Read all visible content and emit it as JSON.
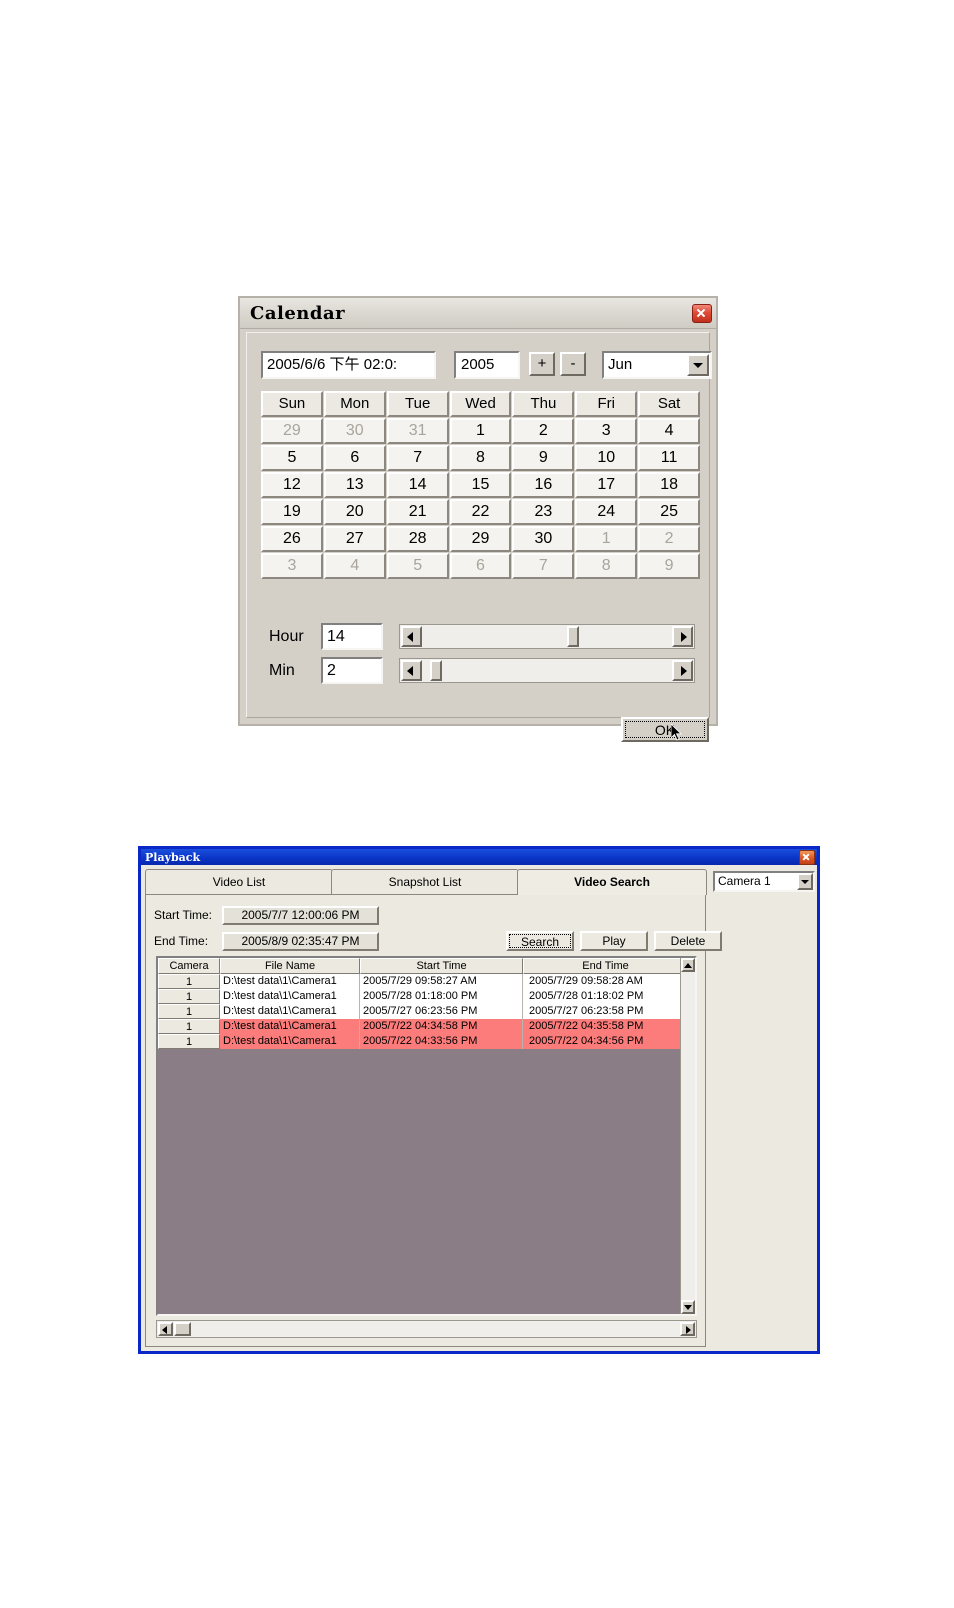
{
  "calendar": {
    "title": "Calendar",
    "close_icon": "close-icon",
    "datetime_value": "2005/6/6 下午 02:0:",
    "year_value": "2005",
    "plus_label": "+",
    "minus_label": "-",
    "month_value": "Jun",
    "month_arrow_icon": "chevron-down-icon",
    "weekdays": [
      "Sun",
      "Mon",
      "Tue",
      "Wed",
      "Thu",
      "Fri",
      "Sat"
    ],
    "weeks": [
      [
        {
          "d": "29",
          "dim": true
        },
        {
          "d": "30",
          "dim": true
        },
        {
          "d": "31",
          "dim": true
        },
        {
          "d": "1",
          "dim": false
        },
        {
          "d": "2",
          "dim": false
        },
        {
          "d": "3",
          "dim": false
        },
        {
          "d": "4",
          "dim": false
        }
      ],
      [
        {
          "d": "5",
          "dim": false
        },
        {
          "d": "6",
          "dim": false
        },
        {
          "d": "7",
          "dim": false
        },
        {
          "d": "8",
          "dim": false
        },
        {
          "d": "9",
          "dim": false
        },
        {
          "d": "10",
          "dim": false
        },
        {
          "d": "11",
          "dim": false
        }
      ],
      [
        {
          "d": "12",
          "dim": false
        },
        {
          "d": "13",
          "dim": false
        },
        {
          "d": "14",
          "dim": false
        },
        {
          "d": "15",
          "dim": false
        },
        {
          "d": "16",
          "dim": false
        },
        {
          "d": "17",
          "dim": false
        },
        {
          "d": "18",
          "dim": false
        }
      ],
      [
        {
          "d": "19",
          "dim": false
        },
        {
          "d": "20",
          "dim": false
        },
        {
          "d": "21",
          "dim": false
        },
        {
          "d": "22",
          "dim": false
        },
        {
          "d": "23",
          "dim": false
        },
        {
          "d": "24",
          "dim": false
        },
        {
          "d": "25",
          "dim": false
        }
      ],
      [
        {
          "d": "26",
          "dim": false
        },
        {
          "d": "27",
          "dim": false
        },
        {
          "d": "28",
          "dim": false
        },
        {
          "d": "29",
          "dim": false
        },
        {
          "d": "30",
          "dim": false
        },
        {
          "d": "1",
          "dim": true
        },
        {
          "d": "2",
          "dim": true
        }
      ],
      [
        {
          "d": "3",
          "dim": true
        },
        {
          "d": "4",
          "dim": true
        },
        {
          "d": "5",
          "dim": true
        },
        {
          "d": "6",
          "dim": true
        },
        {
          "d": "7",
          "dim": true
        },
        {
          "d": "8",
          "dim": true
        },
        {
          "d": "9",
          "dim": true
        }
      ]
    ],
    "hour_label": "Hour",
    "hour_value": "14",
    "hour_thumb_percent": 61,
    "min_label": "Min",
    "min_value": "2",
    "min_thumb_percent": 3,
    "ok_label": "OK"
  },
  "playback": {
    "title": "Playback",
    "close_icon": "close-icon",
    "tabs": [
      {
        "label": "Video List",
        "active": false
      },
      {
        "label": "Snapshot List",
        "active": false
      },
      {
        "label": "Video Search",
        "active": true
      }
    ],
    "camera_selected": "Camera 1",
    "camera_arrow_icon": "chevron-down-icon",
    "start_time_label": "Start Time:",
    "start_time_value": "2005/7/7 12:00:06 PM",
    "end_time_label": "End Time:",
    "end_time_value": "2005/8/9 02:35:47 PM",
    "search_label": "Search",
    "play_label": "Play",
    "delete_label": "Delete",
    "columns": [
      "Camera",
      "File Name",
      "Start Time",
      "End Time"
    ],
    "rows": [
      {
        "camera": "1",
        "file": "D:\\test data\\1\\Camera1",
        "start": "2005/7/29 09:58:27 AM",
        "end": "2005/7/29 09:58:28  AM",
        "alert": false
      },
      {
        "camera": "1",
        "file": "D:\\test data\\1\\Camera1",
        "start": "2005/7/28 01:18:00 PM",
        "end": "2005/7/28  01:18:02 PM",
        "alert": false
      },
      {
        "camera": "1",
        "file": "D:\\test data\\1\\Camera1",
        "start": "2005/7/27 06:23:56 PM",
        "end": "2005/7/27 06:23:58  PM",
        "alert": false
      },
      {
        "camera": "1",
        "file": "D:\\test data\\1\\Camera1",
        "start": "2005/7/22 04:34:58 PM",
        "end": "2005/7/22 04:35:58  PM",
        "alert": true
      },
      {
        "camera": "1",
        "file": "D:\\test data\\1\\Camera1",
        "start": "2005/7/22 04:33:56 PM",
        "end": "2005/7/22 04:34:56  PM",
        "alert": true
      }
    ],
    "scroll_up_icon": "triangle-up-icon",
    "scroll_down_icon": "triangle-down-icon",
    "scroll_left_icon": "triangle-left-icon",
    "scroll_right_icon": "triangle-right-icon",
    "alert_row_color": "#fc7b7b",
    "titlebar_color": "#0a28c8",
    "list_background_color": "#8a7d85"
  }
}
